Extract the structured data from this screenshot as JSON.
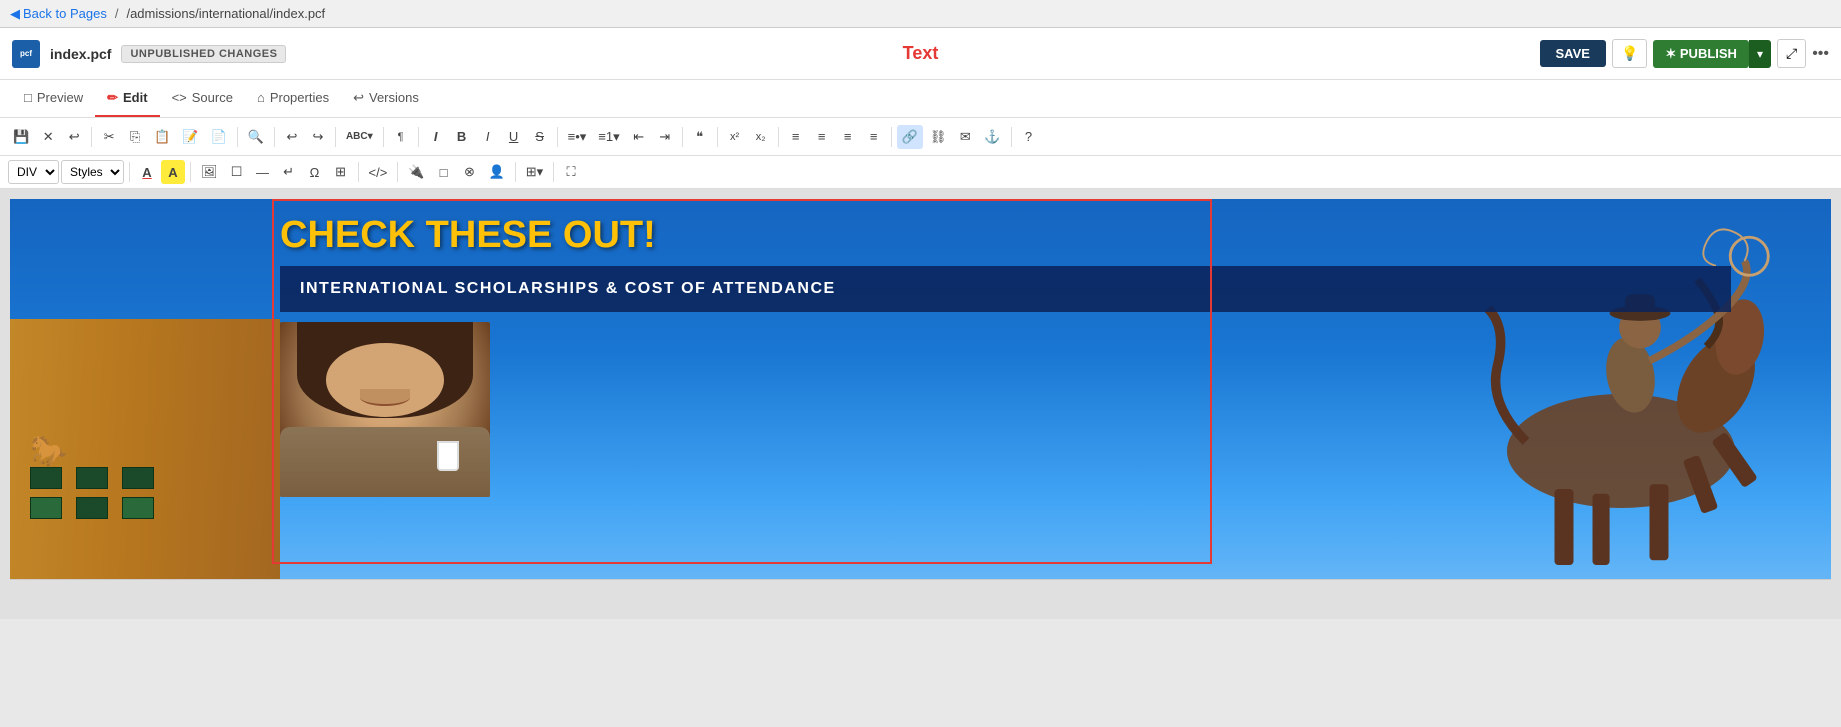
{
  "topnav": {
    "back_label": "Back to Pages",
    "breadcrumb": "/admissions/international/index.pcf"
  },
  "header": {
    "file_icon_text": "pcf",
    "file_name": "index.pcf",
    "unpublished_badge": "UNPUBLISHED CHANGES",
    "center_title": "Text",
    "save_label": "SAVE",
    "publish_label": "✶  PUBLISH",
    "publish_arrow": "▾"
  },
  "tabs": [
    {
      "id": "preview",
      "label": "Preview",
      "icon": "□",
      "active": false
    },
    {
      "id": "edit",
      "label": "Edit",
      "icon": "✏",
      "active": true
    },
    {
      "id": "source",
      "label": "Source",
      "icon": "<>",
      "active": false
    },
    {
      "id": "properties",
      "label": "Properties",
      "icon": "⌂",
      "active": false
    },
    {
      "id": "versions",
      "label": "Versions",
      "icon": "↩",
      "active": false
    }
  ],
  "toolbar1": {
    "buttons": [
      {
        "id": "save-tb",
        "icon": "💾",
        "title": "Save"
      },
      {
        "id": "close-tb",
        "icon": "✕",
        "title": "Close"
      },
      {
        "id": "undo-tb",
        "icon": "↩",
        "title": "Undo"
      },
      {
        "id": "cut-tb",
        "icon": "✂",
        "title": "Cut"
      },
      {
        "id": "copy-tb",
        "icon": "⎘",
        "title": "Copy"
      },
      {
        "id": "paste-tb",
        "icon": "📋",
        "title": "Paste"
      },
      {
        "id": "paste-word-tb",
        "icon": "📝",
        "title": "Paste from Word"
      },
      {
        "id": "paste-text-tb",
        "icon": "📄",
        "title": "Paste as text"
      },
      {
        "id": "find-tb",
        "icon": "🔍",
        "title": "Find"
      },
      {
        "id": "undo2-tb",
        "icon": "↩",
        "title": "Undo"
      },
      {
        "id": "redo-tb",
        "icon": "↪",
        "title": "Redo"
      },
      {
        "id": "spellcheck-tb",
        "icon": "ABC",
        "title": "Spellcheck"
      },
      {
        "id": "format-tb",
        "icon": "¶",
        "title": "Format"
      },
      {
        "id": "italic-caps-tb",
        "icon": "I",
        "title": "Italic"
      },
      {
        "id": "bold-tb",
        "icon": "B",
        "title": "Bold"
      },
      {
        "id": "italic-tb",
        "icon": "𝘐",
        "title": "Italic"
      },
      {
        "id": "underline-tb",
        "icon": "U̲",
        "title": "Underline"
      },
      {
        "id": "strike-tb",
        "icon": "S̶",
        "title": "Strikethrough"
      },
      {
        "id": "ul-tb",
        "icon": "≡•",
        "title": "Unordered list"
      },
      {
        "id": "ol-tb",
        "icon": "≡1",
        "title": "Ordered list"
      },
      {
        "id": "outdent-tb",
        "icon": "⇤",
        "title": "Outdent"
      },
      {
        "id": "indent-tb",
        "icon": "⇥",
        "title": "Indent"
      },
      {
        "id": "quote-tb",
        "icon": "❝",
        "title": "Blockquote"
      },
      {
        "id": "super-tb",
        "icon": "x²",
        "title": "Superscript"
      },
      {
        "id": "sub-tb",
        "icon": "x₂",
        "title": "Subscript"
      },
      {
        "id": "align-left-tb",
        "icon": "≡",
        "title": "Align left"
      },
      {
        "id": "align-center-tb",
        "icon": "≡",
        "title": "Align center"
      },
      {
        "id": "align-right-tb",
        "icon": "≡",
        "title": "Align right"
      },
      {
        "id": "align-justify-tb",
        "icon": "≡",
        "title": "Justify"
      },
      {
        "id": "link-tb",
        "icon": "🔗",
        "title": "Link"
      },
      {
        "id": "unlink-tb",
        "icon": "⛓",
        "title": "Unlink"
      },
      {
        "id": "email-tb",
        "icon": "✉",
        "title": "Email"
      },
      {
        "id": "anchor-tb",
        "icon": "⚓",
        "title": "Anchor"
      },
      {
        "id": "help-tb",
        "icon": "?",
        "title": "Help"
      }
    ]
  },
  "toolbar2": {
    "div_select": "DIV",
    "styles_select": "Styles",
    "buttons": [
      {
        "id": "font-color-tb",
        "icon": "A",
        "title": "Font color"
      },
      {
        "id": "highlight-tb",
        "icon": "A",
        "title": "Highlight"
      },
      {
        "id": "image-tb",
        "icon": "🖼",
        "title": "Image"
      },
      {
        "id": "box-tb",
        "icon": "☐",
        "title": "Box"
      },
      {
        "id": "hr-tb",
        "icon": "—",
        "title": "Horizontal rule"
      },
      {
        "id": "return-tb",
        "icon": "↵",
        "title": "Return"
      },
      {
        "id": "special-char-tb",
        "icon": "Ω",
        "title": "Special character"
      },
      {
        "id": "resize-tb",
        "icon": "⊞",
        "title": "Resize"
      },
      {
        "id": "code-tb",
        "icon": "</>",
        "title": "Code"
      },
      {
        "id": "plugin-tb",
        "icon": "🔌",
        "title": "Plugin"
      },
      {
        "id": "snippet-tb",
        "icon": "□",
        "title": "Snippet"
      },
      {
        "id": "media-tb",
        "icon": "⊗",
        "title": "Media"
      },
      {
        "id": "personalize-tb",
        "icon": "👤",
        "title": "Personalize"
      },
      {
        "id": "table-tb",
        "icon": "⊞",
        "title": "Table"
      },
      {
        "id": "fullscreen-tb",
        "icon": "⛶",
        "title": "Fullscreen"
      }
    ]
  },
  "canvas": {
    "check_text": "CHECK THESE OUT!",
    "scholarships_text": "INTERNATIONAL SCHOLARSHIPS & COST OF ATTENDANCE"
  },
  "colors": {
    "accent_red": "#e53935",
    "accent_yellow": "#FFC107",
    "dark_blue": "#1a237e",
    "save_bg": "#1a3a5c",
    "publish_bg": "#2e7d32"
  }
}
